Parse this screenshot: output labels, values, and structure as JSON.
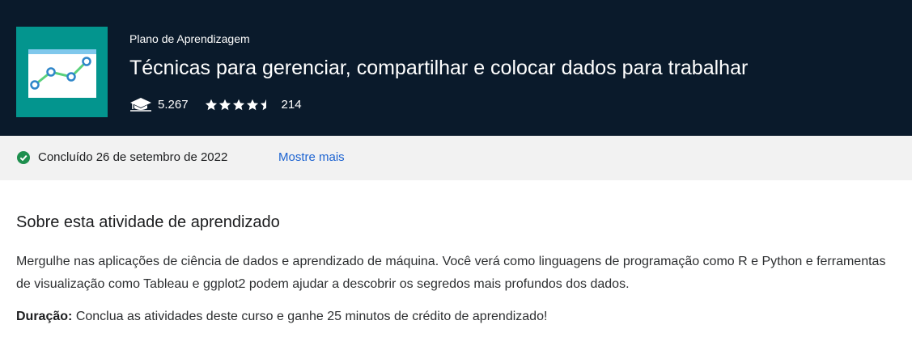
{
  "header": {
    "eyebrow": "Plano de Aprendizagem",
    "title": "Técnicas para gerenciar, compartilhar e colocar dados para trabalhar",
    "learners": "5.267",
    "rating": 4.5,
    "reviews": "214",
    "thumbnail_icon": "line-chart-icon",
    "learners_icon": "graduation-cap-icon",
    "colors": {
      "background": "#0a1a2b",
      "thumbnail": "#03958e",
      "text": "#ffffff"
    }
  },
  "status": {
    "completed_text": "Concluído 26 de setembro de 2022",
    "show_more": "Mostre mais",
    "icon": "check-circle-icon",
    "colors": {
      "check": "#1e8f4e",
      "link": "#1c63d1",
      "background": "#f2f2f2"
    }
  },
  "about": {
    "title": "Sobre esta atividade de aprendizado",
    "description": "Mergulhe nas aplicações de ciência de dados e aprendizado de máquina. Você verá como linguagens de programação como R e Python e ferramentas de visualização como Tableau e ggplot2 podem ajudar a descobrir os segredos mais profundos dos dados.",
    "duration_label": "Duração:",
    "duration_text": "Conclua as atividades deste curso e ganhe 25 minutos de crédito de aprendizado!"
  }
}
